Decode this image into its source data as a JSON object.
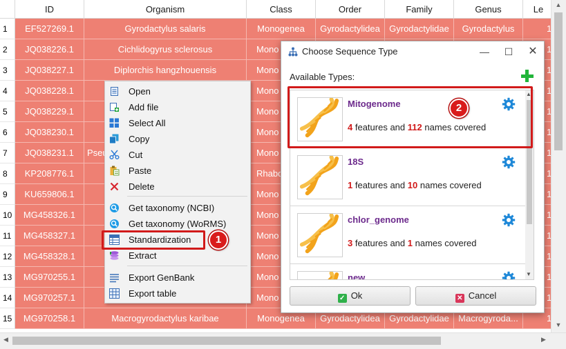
{
  "table": {
    "headers": [
      "ID",
      "Organism",
      "Class",
      "Order",
      "Family",
      "Genus",
      "Le"
    ],
    "rows": [
      {
        "n": "1",
        "id": "EF527269.1",
        "organism": "Gyrodactylus salaris",
        "class": "Monogenea",
        "order": "Gyrodactylidea",
        "family": "Gyrodactylidae",
        "genus": "Gyrodactylus",
        "le": "1"
      },
      {
        "n": "2",
        "id": "JQ038226.1",
        "organism": "Cichlidogyrus sclerosus",
        "class": "Mono",
        "order": "",
        "family": "",
        "genus": "",
        "le": "1"
      },
      {
        "n": "3",
        "id": "JQ038227.1",
        "organism": "Diplorchis hangzhouensis",
        "class": "Mono",
        "order": "",
        "family": "",
        "genus": "",
        "le": "1"
      },
      {
        "n": "4",
        "id": "JQ038228.1",
        "organism": "",
        "class": "Mono",
        "order": "",
        "family": "",
        "genus": "",
        "le": "1"
      },
      {
        "n": "5",
        "id": "JQ038229.1",
        "organism": "",
        "class": "Mono",
        "order": "",
        "family": "",
        "genus": "",
        "le": "1"
      },
      {
        "n": "6",
        "id": "JQ038230.1",
        "organism": "",
        "class": "Mono",
        "order": "",
        "family": "",
        "genus": "",
        "le": "1"
      },
      {
        "n": "7",
        "id": "JQ038231.1",
        "organism": "Pseu",
        "class": "Mono",
        "order": "",
        "family": "",
        "genus": "",
        "le": "1"
      },
      {
        "n": "8",
        "id": "KP208776.1",
        "organism": "",
        "class": "Rhabdit",
        "order": "",
        "family": "",
        "genus": "",
        "le": "1"
      },
      {
        "n": "9",
        "id": "KU659806.1",
        "organism": "",
        "class": "Mono",
        "order": "",
        "family": "",
        "genus": "",
        "le": "1"
      },
      {
        "n": "10",
        "id": "MG458326.1",
        "organism": "",
        "class": "Mono",
        "order": "",
        "family": "",
        "genus": "",
        "le": "1"
      },
      {
        "n": "11",
        "id": "MG458327.1",
        "organism": "",
        "class": "Mono",
        "order": "",
        "family": "",
        "genus": "",
        "le": "1"
      },
      {
        "n": "12",
        "id": "MG458328.1",
        "organism": "",
        "class": "Mono",
        "order": "",
        "family": "",
        "genus": "",
        "le": "1"
      },
      {
        "n": "13",
        "id": "MG970255.1",
        "organism": "",
        "class": "Mono",
        "order": "",
        "family": "",
        "genus": "",
        "le": "1"
      },
      {
        "n": "14",
        "id": "MG970257.1",
        "organism": "",
        "class": "Mono",
        "order": "",
        "family": "",
        "genus": "",
        "le": "1"
      },
      {
        "n": "15",
        "id": "MG970258.1",
        "organism": "Macrogyrodactylus karibae",
        "class": "Monogenea",
        "order": "Gyrodactylidea",
        "family": "Gyrodactylidae",
        "genus": "Macrogyroda...",
        "le": "1"
      }
    ]
  },
  "context_menu": {
    "items": [
      {
        "label": "Open",
        "icon": "open-icon"
      },
      {
        "label": "Add file",
        "icon": "add-file-icon"
      },
      {
        "label": "Select All",
        "icon": "select-all-icon"
      },
      {
        "label": "Copy",
        "icon": "copy-icon"
      },
      {
        "label": "Cut",
        "icon": "cut-icon"
      },
      {
        "label": "Paste",
        "icon": "paste-icon"
      },
      {
        "label": "Delete",
        "icon": "delete-icon"
      },
      {
        "label": "Get taxonomy (NCBI)",
        "icon": "taxonomy-ncbi-icon"
      },
      {
        "label": "Get taxonomy (WoRMS)",
        "icon": "taxonomy-worms-icon"
      },
      {
        "label": "Standardization",
        "icon": "standardization-icon"
      },
      {
        "label": "Extract",
        "icon": "extract-icon"
      },
      {
        "label": "Export GenBank",
        "icon": "export-genbank-icon"
      },
      {
        "label": "Export table",
        "icon": "export-table-icon"
      }
    ]
  },
  "annotations": {
    "step1": "1",
    "step2": "2",
    "highlight_color": "#d11a1a"
  },
  "dialog": {
    "title": "Choose Sequence Type",
    "available_label": "Available Types:",
    "types": [
      {
        "name": "Mitogenome",
        "features": "4",
        "names": "112",
        "features_text": "features and",
        "names_text": "names covered"
      },
      {
        "name": "18S",
        "features": "1",
        "names": "10",
        "features_text": "features and",
        "names_text": "names covered"
      },
      {
        "name": "chlor_genome",
        "features": "3",
        "names": "1",
        "features_text": "features and",
        "names_text": "names covered"
      },
      {
        "name": "new",
        "features": "",
        "names": "",
        "features_text": "",
        "names_text": ""
      }
    ],
    "ok_label": "Ok",
    "cancel_label": "Cancel"
  },
  "colors": {
    "row_selected": "#ee8073",
    "type_name": "#6c2a8c",
    "count": "#d11a1a",
    "accent_green": "#22b53a",
    "gear_blue": "#1e88d8"
  }
}
